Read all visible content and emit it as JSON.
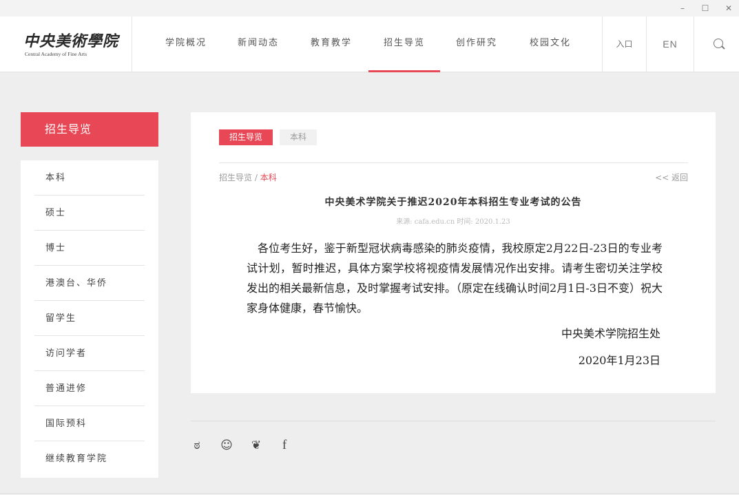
{
  "window": {
    "min_glyph": "–",
    "max_glyph": "☐",
    "close_glyph": "✕"
  },
  "header": {
    "logo_cn": "中央美術學院",
    "logo_en": "Central Academy of Fine Arts",
    "nav": [
      "学院概况",
      "新闻动态",
      "教育教学",
      "招生导览",
      "创作研究",
      "校园文化"
    ],
    "active_nav": "招生导览",
    "entry_label": "入口",
    "en_label": "EN"
  },
  "sidebar": {
    "title": "招生导览",
    "items": [
      "本科",
      "硕士",
      "博士",
      "港澳台、华侨",
      "留学生",
      "访问学者",
      "普通进修",
      "国际预科",
      "继续教育学院"
    ]
  },
  "main": {
    "tabs": [
      "招生导览",
      "本科"
    ],
    "breadcrumb": {
      "root": "招生导览",
      "sep": " / ",
      "current": "本科"
    },
    "back_label": "<< 返回",
    "title": "中央美术学院关于推迟2020年本科招生专业考试的公告",
    "meta": "来源: cafa.edu.cn   时间: 2020.1.23",
    "body": "各位考生好，鉴于新型冠状病毒感染的肺炎疫情，我校原定2月22日-23日的专业考试计划，暂时推迟，具体方案学校将视疫情发展情况作出安排。请考生密切关注学校发出的相关最新信息，及时掌握考试安排。（原定在线确认时间2月1日-3日不变）祝大家身体健康，春节愉快。",
    "signature": "中央美术学院招生处",
    "date": "2020年1月23日"
  },
  "footer": {
    "social": [
      {
        "name": "weibo-icon",
        "glyph": "ಠ"
      },
      {
        "name": "wechat-icon",
        "glyph": "☺"
      },
      {
        "name": "twitter-icon",
        "glyph": "❦"
      },
      {
        "name": "facebook-icon",
        "glyph": "f"
      }
    ]
  },
  "colors": {
    "accent": "#e84855",
    "background": "#eeeeee"
  }
}
